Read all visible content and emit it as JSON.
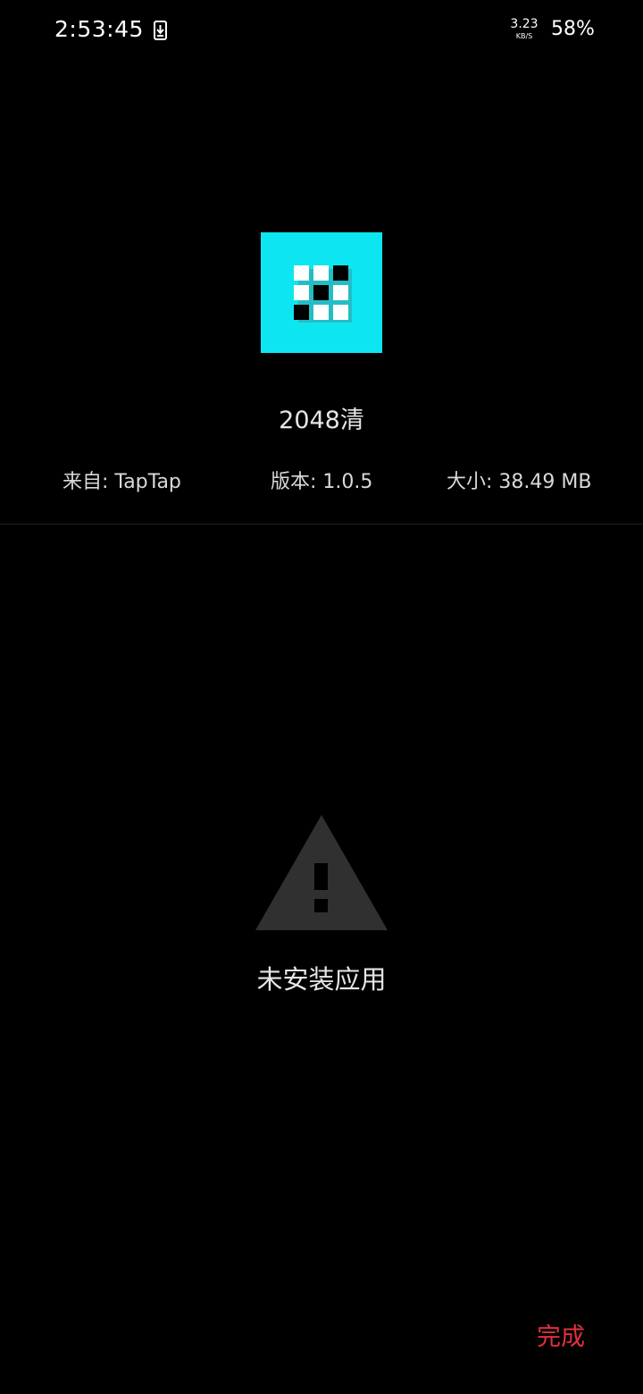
{
  "status_bar": {
    "time": "2:53:45",
    "download_icon": "download-arrow-icon",
    "net_speed_value": "3.23",
    "net_speed_unit": "KB/S",
    "battery": "58%"
  },
  "app": {
    "icon": "grid-tiles-app-icon",
    "icon_color": "#0de6f0",
    "name": "2048清",
    "source": "来自: TapTap",
    "version": "版本: 1.0.5",
    "size": "大小: 38.49 MB"
  },
  "status": {
    "icon": "warning-triangle-icon",
    "message": "未安装应用"
  },
  "actions": {
    "done_label": "完成",
    "accent_color": "#e0303f"
  }
}
